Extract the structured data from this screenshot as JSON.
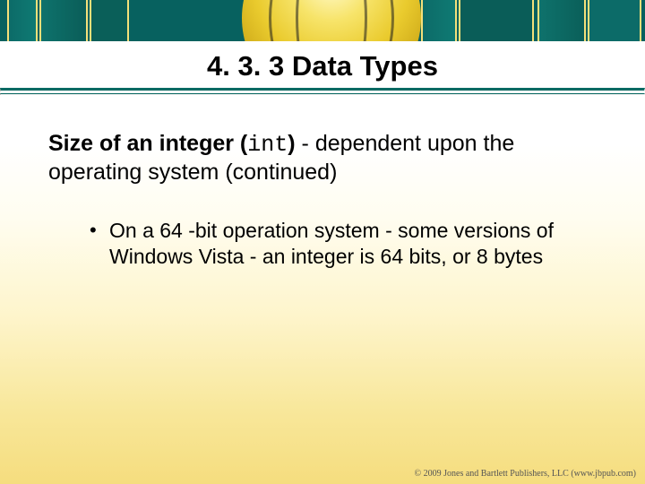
{
  "title": "4. 3. 3 Data Types",
  "lead": {
    "bold_prefix": "Size of an integer (",
    "code": "int",
    "bold_suffix": ")",
    "rest": " - dependent upon the operating system (continued)"
  },
  "bullets": [
    "On a 64 -bit operation system - some versions of Windows Vista -  an integer is 64 bits, or 8 bytes"
  ],
  "footer": "© 2009 Jones and Bartlett Publishers, LLC (www.jbpub.com)"
}
